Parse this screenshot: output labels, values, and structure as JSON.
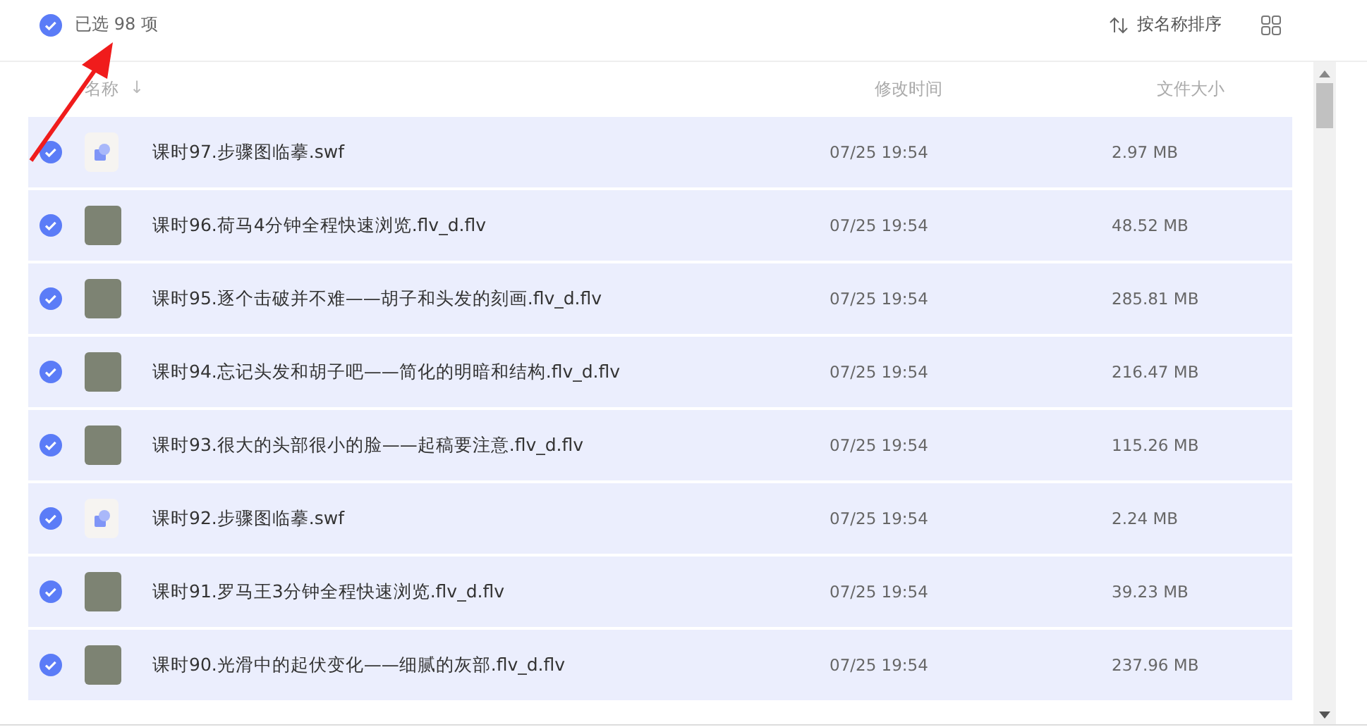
{
  "selection": {
    "checked": true,
    "label": "已选 98 项"
  },
  "toolbar": {
    "sort_label": "按名称排序"
  },
  "table": {
    "columns": [
      {
        "label": "名称",
        "sort_icon": "↓"
      },
      {
        "label": "修改时间"
      },
      {
        "label": "文件大小"
      }
    ],
    "rows": [
      {
        "kind": "swf",
        "selected": true,
        "name": "课时97.步骤图临摹.swf",
        "modified": "07/25 19:54",
        "size": "2.97 MB"
      },
      {
        "kind": "video",
        "selected": true,
        "name": "课时96.荷马4分钟全程快速浏览.flv_d.flv",
        "modified": "07/25 19:54",
        "size": "48.52 MB"
      },
      {
        "kind": "video",
        "selected": true,
        "name": "课时95.逐个击破并不难——胡子和头发的刻画.flv_d.flv",
        "modified": "07/25 19:54",
        "size": "285.81 MB"
      },
      {
        "kind": "video",
        "selected": true,
        "name": "课时94.忘记头发和胡子吧——简化的明暗和结构.flv_d.flv",
        "modified": "07/25 19:54",
        "size": "216.47 MB"
      },
      {
        "kind": "video",
        "selected": true,
        "name": "课时93.很大的头部很小的脸——起稿要注意.flv_d.flv",
        "modified": "07/25 19:54",
        "size": "115.26 MB"
      },
      {
        "kind": "swf",
        "selected": true,
        "name": "课时92.步骤图临摹.swf",
        "modified": "07/25 19:54",
        "size": "2.24 MB"
      },
      {
        "kind": "video",
        "selected": true,
        "name": "课时91.罗马王3分钟全程快速浏览.flv_d.flv",
        "modified": "07/25 19:54",
        "size": "39.23 MB"
      },
      {
        "kind": "video",
        "selected": true,
        "name": "课时90.光滑中的起伏变化——细腻的灰部.flv_d.flv",
        "modified": "07/25 19:54",
        "size": "237.96 MB"
      }
    ]
  }
}
